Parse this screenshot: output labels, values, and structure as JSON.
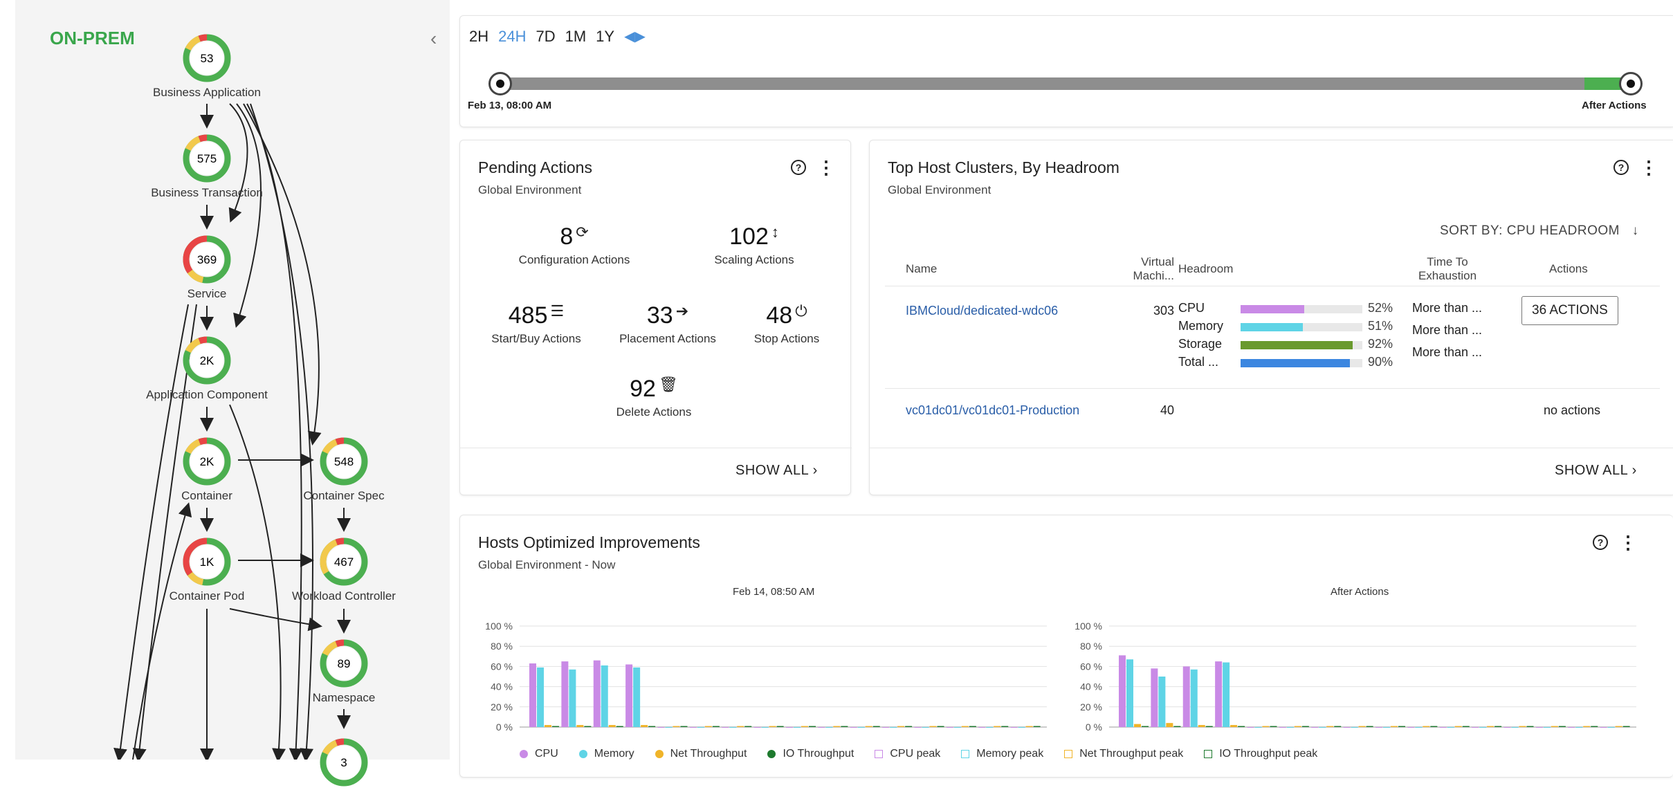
{
  "supply_chain": {
    "title": "ON-PREM",
    "nodes": [
      {
        "label": "Business Application",
        "count": "53"
      },
      {
        "label": "Business Transaction",
        "count": "575"
      },
      {
        "label": "Service",
        "count": "369"
      },
      {
        "label": "Application Component",
        "count": "2K"
      },
      {
        "label": "Container",
        "count": "2K"
      },
      {
        "label": "Container Spec",
        "count": "548"
      },
      {
        "label": "Container Pod",
        "count": "1K"
      },
      {
        "label": "Workload Controller",
        "count": "467"
      },
      {
        "label": "Namespace",
        "count": "89"
      },
      {
        "label": "",
        "count": "3"
      }
    ]
  },
  "timeline": {
    "ranges": [
      "2H",
      "24H",
      "7D",
      "1M",
      "1Y"
    ],
    "active_range": "24H",
    "start_label": "Feb 13, 08:00 AM",
    "end_label": "After Actions"
  },
  "pending": {
    "title": "Pending Actions",
    "subtitle": "Global Environment",
    "stats": [
      {
        "num": "8",
        "label": "Configuration Actions",
        "icon": "refresh-icon"
      },
      {
        "num": "102",
        "label": "Scaling Actions",
        "icon": "resize-vertical-icon"
      },
      {
        "num": "485",
        "label": "Start/Buy Actions",
        "icon": "server-stack-icon"
      },
      {
        "num": "33",
        "label": "Placement Actions",
        "icon": "arrow-right-icon"
      },
      {
        "num": "48",
        "label": "Stop Actions",
        "icon": "power-icon"
      },
      {
        "num": "92",
        "label": "Delete Actions",
        "icon": "trash-icon"
      }
    ],
    "show_all": "SHOW ALL"
  },
  "clusters": {
    "title": "Top Host Clusters, By Headroom",
    "subtitle": "Global Environment",
    "sort_by": "SORT BY: CPU HEADROOM",
    "headers": {
      "name": "Name",
      "vms": "Virtual Machi...",
      "headroom": "Headroom",
      "tte": "Time To Exhaustion",
      "actions": "Actions"
    },
    "rows": [
      {
        "name": "IBMCloud/dedicated-wdc06",
        "vms": "303",
        "metrics": [
          {
            "label": "CPU",
            "pct": "52%",
            "value": 52,
            "color": "#c98ae6",
            "tte": "More than ..."
          },
          {
            "label": "Memory",
            "pct": "51%",
            "value": 51,
            "color": "#5fd4e6",
            "tte": "More than ..."
          },
          {
            "label": "Storage",
            "pct": "92%",
            "value": 92,
            "color": "#6a9a2e",
            "tte": "More than ..."
          },
          {
            "label": "Total ...",
            "pct": "90%",
            "value": 90,
            "color": "#3b86e0",
            "tte": ""
          }
        ],
        "action": "36 ACTIONS"
      },
      {
        "name": "vc01dc01/vc01dc01-Production",
        "vms": "40",
        "action": "no actions"
      }
    ],
    "show_all": "SHOW ALL"
  },
  "hosts": {
    "title": "Hosts Optimized Improvements",
    "subtitle": "Global Environment - Now",
    "chart_left_title": "Feb 14, 08:50 AM",
    "chart_right_title": "After Actions",
    "legend": [
      {
        "name": "CPU",
        "color": "#c98ae6",
        "filled": true
      },
      {
        "name": "Memory",
        "color": "#5fd4e6",
        "filled": true
      },
      {
        "name": "Net Throughput",
        "color": "#f0b429",
        "filled": true
      },
      {
        "name": "IO Throughput",
        "color": "#1e7a2e",
        "filled": true
      },
      {
        "name": "CPU peak",
        "color": "#c98ae6",
        "filled": false
      },
      {
        "name": "Memory peak",
        "color": "#5fd4e6",
        "filled": false
      },
      {
        "name": "Net Throughput peak",
        "color": "#f0b429",
        "filled": false
      },
      {
        "name": "IO Throughput peak",
        "color": "#1e7a2e",
        "filled": false
      }
    ]
  },
  "chart_data": [
    {
      "type": "bar",
      "title": "Feb 14, 08:50 AM",
      "ylim": [
        0,
        100
      ],
      "yticks": [
        "0 %",
        "20 %",
        "40 %",
        "60 %",
        "80 %",
        "100 %"
      ],
      "series": [
        {
          "name": "CPU",
          "values": [
            63,
            65,
            66,
            62,
            0,
            0,
            0,
            0,
            0,
            0,
            0,
            0,
            0,
            0,
            0,
            0
          ]
        },
        {
          "name": "Memory",
          "values": [
            59,
            57,
            61,
            59,
            0,
            0,
            0,
            0,
            0,
            0,
            0,
            0,
            0,
            0,
            0,
            0
          ]
        },
        {
          "name": "Net Throughput",
          "values": [
            2,
            2,
            2,
            2,
            1,
            1,
            1,
            1,
            1,
            1,
            1,
            1,
            1,
            1,
            1,
            1
          ]
        },
        {
          "name": "IO Throughput",
          "values": [
            1,
            1,
            1,
            1,
            1,
            1,
            1,
            1,
            1,
            1,
            1,
            1,
            1,
            1,
            1,
            1
          ]
        }
      ]
    },
    {
      "type": "bar",
      "title": "After Actions",
      "ylim": [
        0,
        100
      ],
      "yticks": [
        "0 %",
        "20 %",
        "40 %",
        "60 %",
        "80 %",
        "100 %"
      ],
      "series": [
        {
          "name": "CPU",
          "values": [
            71,
            58,
            60,
            65,
            0,
            0,
            0,
            0,
            0,
            0,
            0,
            0,
            0,
            0,
            0,
            0
          ]
        },
        {
          "name": "Memory",
          "values": [
            67,
            50,
            57,
            64,
            0,
            0,
            0,
            0,
            0,
            0,
            0,
            0,
            0,
            0,
            0,
            0
          ]
        },
        {
          "name": "Net Throughput",
          "values": [
            3,
            4,
            2,
            2,
            1,
            1,
            1,
            1,
            1,
            1,
            1,
            1,
            1,
            1,
            1,
            1
          ]
        },
        {
          "name": "IO Throughput",
          "values": [
            1,
            1,
            1,
            1,
            1,
            1,
            1,
            1,
            1,
            1,
            1,
            1,
            1,
            1,
            1,
            1
          ]
        }
      ]
    }
  ]
}
